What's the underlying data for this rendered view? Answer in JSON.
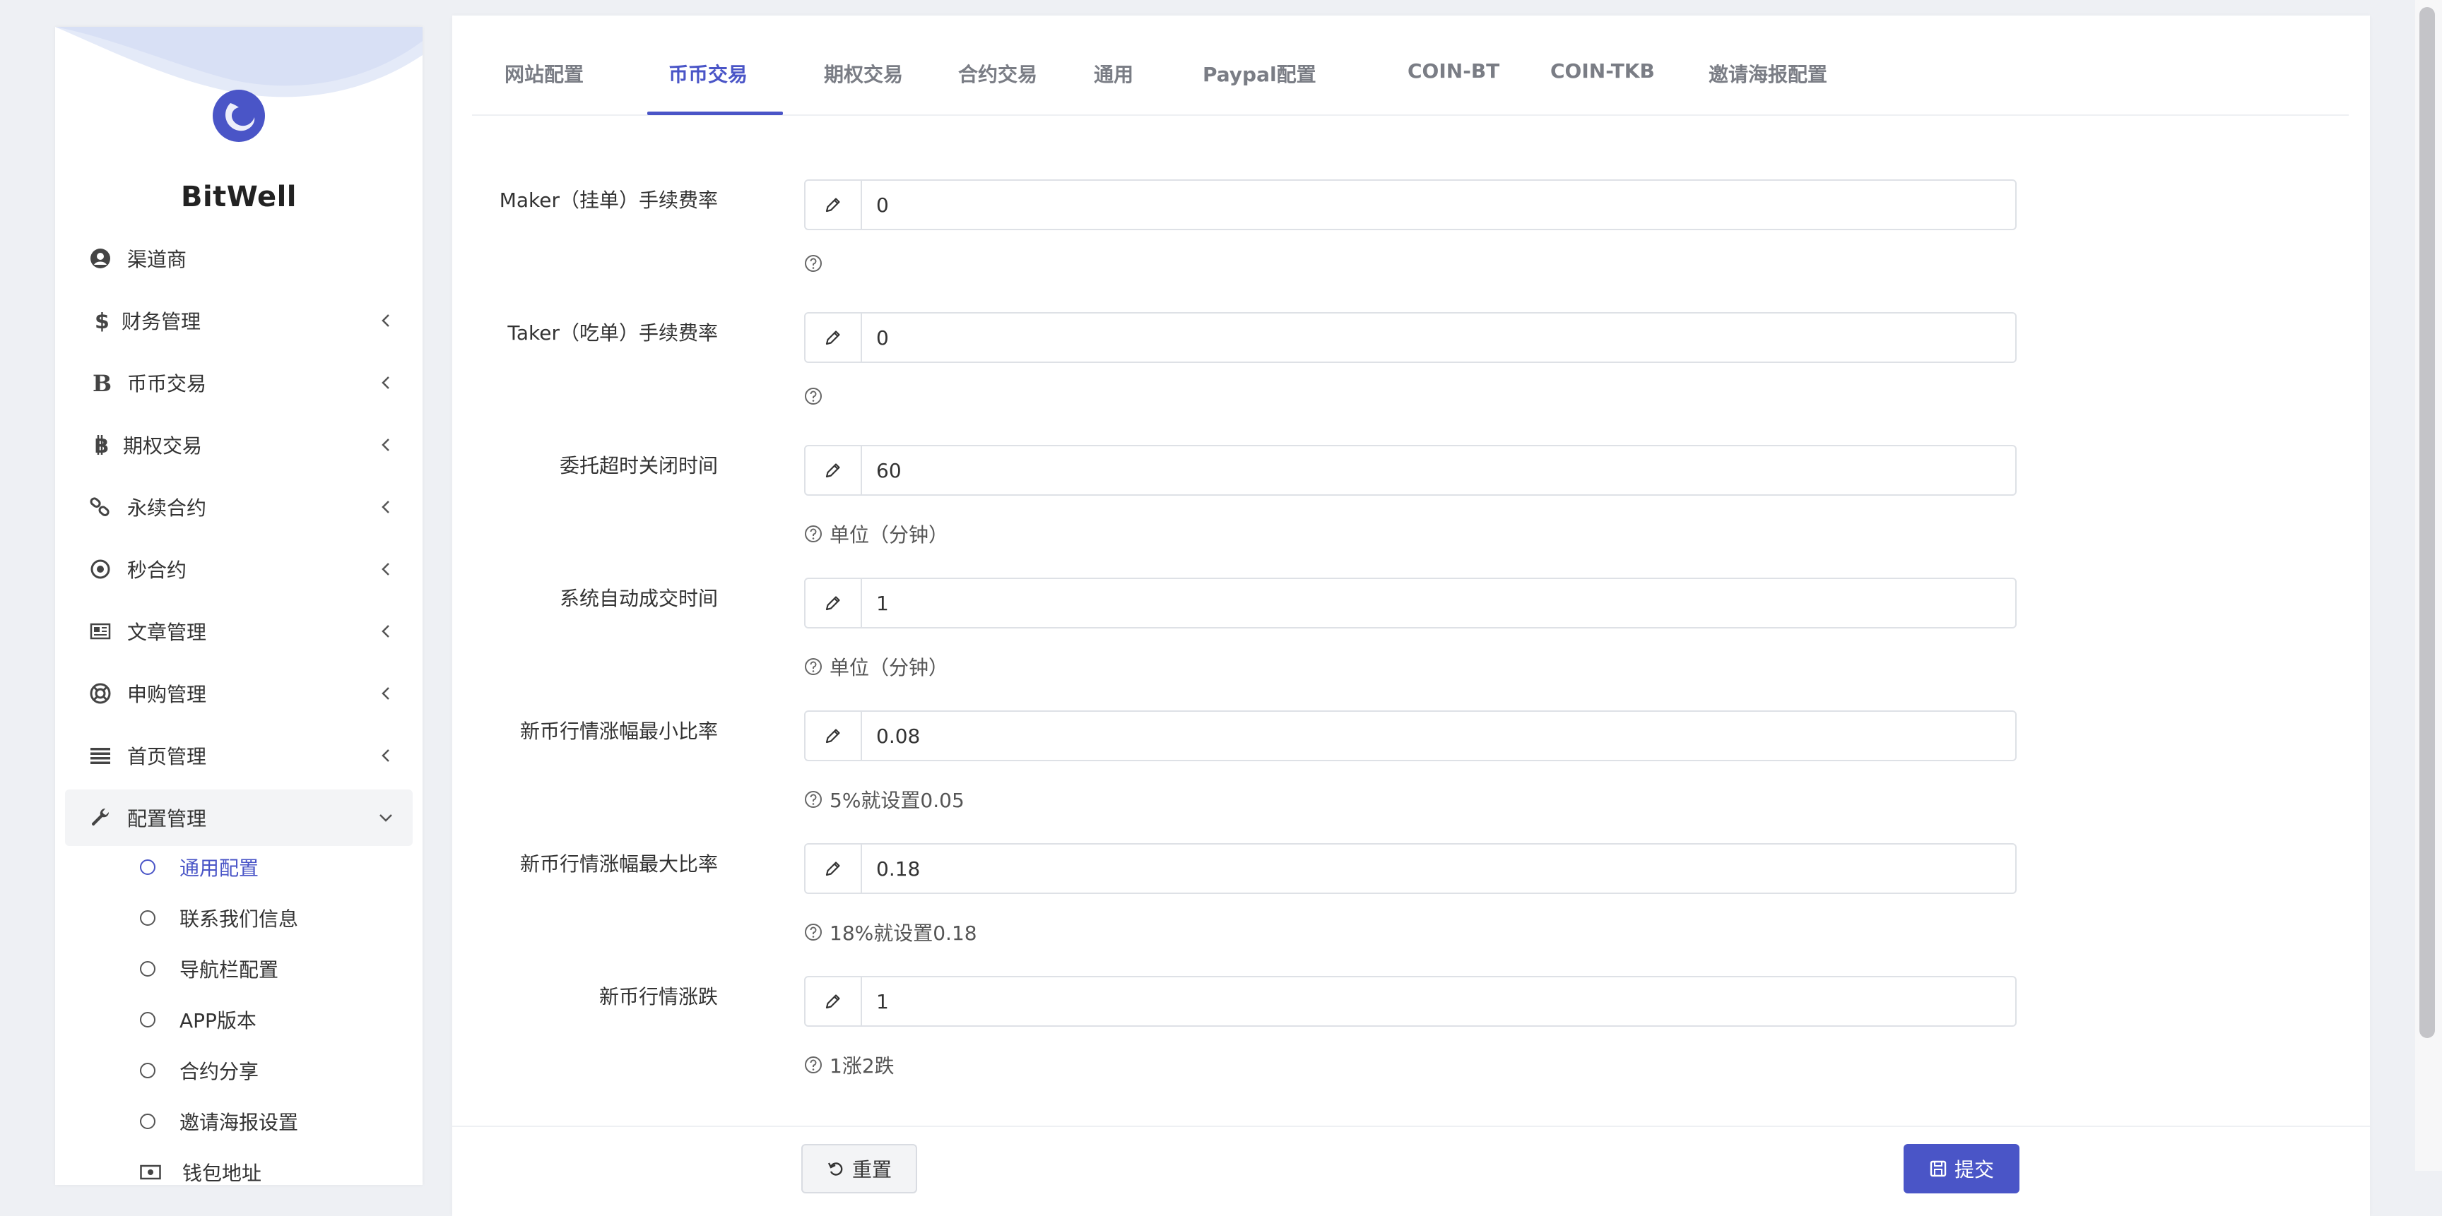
{
  "sidebar": {
    "brand": "BitWell",
    "items": [
      {
        "label": "渠道商",
        "icon": "user-circle-icon"
      },
      {
        "label": "财务管理",
        "icon": "dollar-icon"
      },
      {
        "label": "币币交易",
        "icon": "bold-b-icon"
      },
      {
        "label": "期权交易",
        "icon": "bitcoin-icon"
      },
      {
        "label": "永续合约",
        "icon": "link-icon"
      },
      {
        "label": "秒合约",
        "icon": "target-icon"
      },
      {
        "label": "文章管理",
        "icon": "newspaper-icon"
      },
      {
        "label": "申购管理",
        "icon": "lifebuoy-icon"
      },
      {
        "label": "首页管理",
        "icon": "list-icon"
      },
      {
        "label": "配置管理",
        "icon": "wrench-icon"
      }
    ],
    "sub_items": [
      {
        "label": "通用配置"
      },
      {
        "label": "联系我们信息"
      },
      {
        "label": "导航栏配置"
      },
      {
        "label": "APP版本"
      },
      {
        "label": "合约分享"
      },
      {
        "label": "邀请海报设置"
      },
      {
        "label": "钱包地址"
      }
    ]
  },
  "tabs": [
    {
      "label": "网站配置"
    },
    {
      "label": "币币交易"
    },
    {
      "label": "期权交易"
    },
    {
      "label": "合约交易"
    },
    {
      "label": "通用"
    },
    {
      "label": "Paypal配置"
    },
    {
      "label": "COIN-BT"
    },
    {
      "label": "COIN-TKB"
    },
    {
      "label": "邀请海报配置"
    }
  ],
  "active_tab": "币币交易",
  "form": {
    "fields": [
      {
        "label": "Maker（挂单）手续费率",
        "value": "0",
        "help": ""
      },
      {
        "label": "Taker（吃单）手续费率",
        "value": "0",
        "help": ""
      },
      {
        "label": "委托超时关闭时间",
        "value": "60",
        "help": "单位（分钟）"
      },
      {
        "label": "系统自动成交时间",
        "value": "1",
        "help": "单位（分钟）"
      },
      {
        "label": "新币行情涨幅最小比率",
        "value": "0.08",
        "help": "5%就设置0.05"
      },
      {
        "label": "新币行情涨幅最大比率",
        "value": "0.18",
        "help": "18%就设置0.18"
      },
      {
        "label": "新币行情涨跌",
        "value": "1",
        "help": "1涨2跌"
      }
    ],
    "reset_label": "重置",
    "submit_label": "提交"
  },
  "colors": {
    "accent": "#4a55c7",
    "background": "#eef0f4"
  }
}
